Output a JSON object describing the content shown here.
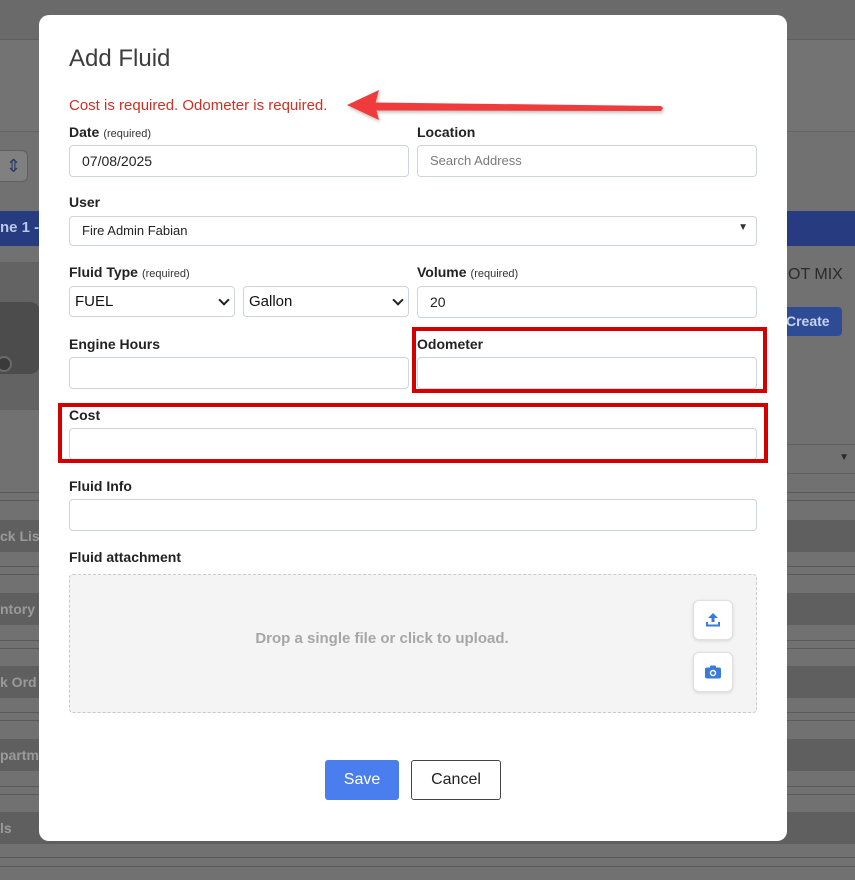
{
  "background": {
    "band_label": "ne 1 -",
    "otmix_label": "OT MIX",
    "create_label": "Create",
    "sections": [
      "ck List",
      "ntory",
      "k Ord",
      "partm",
      "ls"
    ]
  },
  "modal": {
    "title": "Add Fluid",
    "error": "Cost is required. Odometer is required.",
    "required_tag": "(required)",
    "date": {
      "label": "Date",
      "value": "07/08/2025"
    },
    "location": {
      "label": "Location",
      "placeholder": "Search Address"
    },
    "user": {
      "label": "User",
      "value": "Fire Admin Fabian"
    },
    "fluid_type": {
      "label": "Fluid Type",
      "value": "FUEL",
      "unit": "Gallon"
    },
    "volume": {
      "label": "Volume",
      "value": "20"
    },
    "engine_hours": {
      "label": "Engine Hours",
      "value": ""
    },
    "odometer": {
      "label": "Odometer",
      "value": ""
    },
    "cost": {
      "label": "Cost",
      "value": ""
    },
    "fluid_info": {
      "label": "Fluid Info",
      "value": ""
    },
    "attachment": {
      "label": "Fluid attachment",
      "hint": "Drop a single file or click to upload."
    },
    "save_label": "Save",
    "cancel_label": "Cancel"
  },
  "colors": {
    "error": "#d12f23",
    "highlight": "#d30000",
    "primary": "#4a7eef",
    "annotation_arrow": "#ef3b3b"
  }
}
